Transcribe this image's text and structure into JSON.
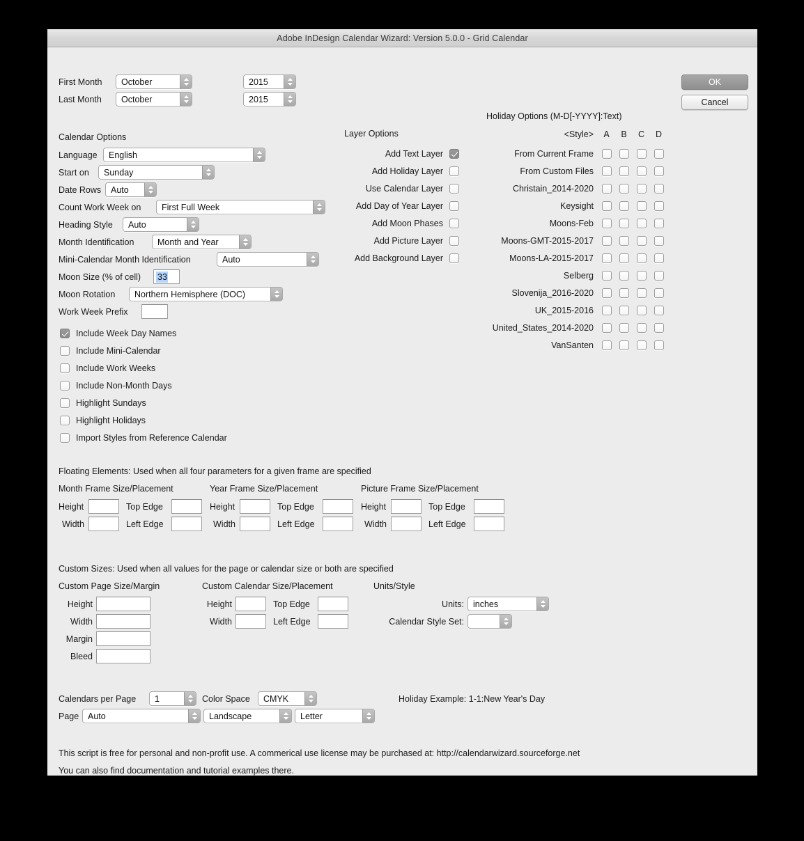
{
  "window": {
    "title": "Adobe InDesign Calendar Wizard: Version 5.0.0 - Grid Calendar"
  },
  "buttons": {
    "ok": "OK",
    "cancel": "Cancel"
  },
  "month_range": {
    "first_month_label": "First Month",
    "first_month_value": "October",
    "first_year_value": "2015",
    "last_month_label": "Last Month",
    "last_month_value": "October",
    "last_year_value": "2015"
  },
  "calendar_options": {
    "title": "Calendar Options",
    "fields": [
      {
        "label": "Language",
        "value": "English",
        "type": "popup"
      },
      {
        "label": "Start on",
        "value": "Sunday",
        "type": "popup"
      },
      {
        "label": "Date Rows",
        "value": "Auto",
        "type": "popup"
      },
      {
        "label": "Count Work Week on",
        "value": "First Full Week",
        "type": "popup"
      },
      {
        "label": "Heading Style",
        "value": "Auto",
        "type": "popup"
      },
      {
        "label": "Month Identification",
        "value": "Month and Year",
        "type": "popup"
      },
      {
        "label": "Mini-Calendar Month Identification",
        "value": "Auto",
        "type": "popup"
      },
      {
        "label": "Moon Size (% of cell)",
        "value": "33",
        "type": "text"
      },
      {
        "label": "Moon Rotation",
        "value": "Northern Hemisphere (DOC)",
        "type": "popup"
      },
      {
        "label": "Work Week Prefix",
        "value": "",
        "type": "text"
      }
    ],
    "checkboxes": [
      {
        "label": "Include Week Day Names",
        "checked": true
      },
      {
        "label": "Include Mini-Calendar",
        "checked": false
      },
      {
        "label": "Include Work Weeks",
        "checked": false
      },
      {
        "label": "Include Non-Month Days",
        "checked": false
      },
      {
        "label": "Highlight Sundays",
        "checked": false
      },
      {
        "label": "Highlight Holidays",
        "checked": false
      },
      {
        "label": "Import Styles from Reference Calendar",
        "checked": false
      }
    ]
  },
  "layer_options": {
    "title": "Layer Options",
    "items": [
      {
        "label": "Add Text Layer",
        "checked": true
      },
      {
        "label": "Add Holiday Layer",
        "checked": false
      },
      {
        "label": "Use Calendar Layer",
        "checked": false
      },
      {
        "label": "Add Day of Year Layer",
        "checked": false
      },
      {
        "label": "Add Moon Phases",
        "checked": false
      },
      {
        "label": "Add Picture Layer",
        "checked": false
      },
      {
        "label": "Add Background Layer",
        "checked": false
      }
    ]
  },
  "holiday_options": {
    "title": "Holiday Options (M-D[-YYYY]:Text)",
    "style_header": "<Style>",
    "columns": [
      "A",
      "B",
      "C",
      "D"
    ],
    "rows": [
      {
        "label": "From Current Frame",
        "checked": [
          false,
          false,
          false,
          false
        ]
      },
      {
        "label": "From Custom Files",
        "checked": [
          false,
          false,
          false,
          false
        ]
      },
      {
        "label": "Christain_2014-2020",
        "checked": [
          false,
          false,
          false,
          false
        ]
      },
      {
        "label": "Keysight",
        "checked": [
          false,
          false,
          false,
          false
        ]
      },
      {
        "label": "Moons-Feb",
        "checked": [
          false,
          false,
          false,
          false
        ]
      },
      {
        "label": "Moons-GMT-2015-2017",
        "checked": [
          false,
          false,
          false,
          false
        ]
      },
      {
        "label": "Moons-LA-2015-2017",
        "checked": [
          false,
          false,
          false,
          false
        ]
      },
      {
        "label": "Selberg",
        "checked": [
          false,
          false,
          false,
          false
        ]
      },
      {
        "label": "Slovenija_2016-2020",
        "checked": [
          false,
          false,
          false,
          false
        ]
      },
      {
        "label": "UK_2015-2016",
        "checked": [
          false,
          false,
          false,
          false
        ]
      },
      {
        "label": "United_States_2014-2020",
        "checked": [
          false,
          false,
          false,
          false
        ]
      },
      {
        "label": "VanSanten",
        "checked": [
          false,
          false,
          false,
          false
        ]
      }
    ]
  },
  "floating_elements": {
    "heading": "Floating Elements: Used when all four parameters for a given frame are specified",
    "groups": [
      {
        "title": "Month Frame Size/Placement",
        "fields": [
          {
            "label": "Height",
            "value": ""
          },
          {
            "label": "Top Edge",
            "value": ""
          },
          {
            "label": "Width",
            "value": ""
          },
          {
            "label": "Left Edge",
            "value": ""
          }
        ]
      },
      {
        "title": "Year Frame Size/Placement",
        "fields": [
          {
            "label": "Height",
            "value": ""
          },
          {
            "label": "Top Edge",
            "value": ""
          },
          {
            "label": "Width",
            "value": ""
          },
          {
            "label": "Left Edge",
            "value": ""
          }
        ]
      },
      {
        "title": "Picture Frame Size/Placement",
        "fields": [
          {
            "label": "Height",
            "value": ""
          },
          {
            "label": "Top Edge",
            "value": ""
          },
          {
            "label": "Width",
            "value": ""
          },
          {
            "label": "Left Edge",
            "value": ""
          }
        ]
      }
    ]
  },
  "custom_sizes": {
    "heading": "Custom Sizes: Used when all values for the page or calendar size or both are specified",
    "page_group": {
      "title": "Custom Page Size/Margin",
      "fields": [
        {
          "label": "Height",
          "value": ""
        },
        {
          "label": "Width",
          "value": ""
        },
        {
          "label": "Margin",
          "value": ""
        },
        {
          "label": "Bleed",
          "value": ""
        }
      ]
    },
    "calendar_group": {
      "title": "Custom Calendar Size/Placement",
      "fields": [
        {
          "label": "Height",
          "value": ""
        },
        {
          "label": "Top Edge",
          "value": ""
        },
        {
          "label": "Width",
          "value": ""
        },
        {
          "label": "Left Edge",
          "value": ""
        }
      ]
    },
    "units_group": {
      "title": "Units/Style",
      "units_label": "Units:",
      "units_value": "inches",
      "style_set_label": "Calendar Style Set:",
      "style_set_value": ""
    }
  },
  "bottom": {
    "calendars_per_page_label": "Calendars per Page",
    "calendars_per_page_value": "1",
    "color_space_label": "Color Space",
    "color_space_value": "CMYK",
    "page_label": "Page",
    "page_value": "Auto",
    "orientation_value": "Landscape",
    "paper_value": "Letter",
    "holiday_example": "Holiday Example: 1-1:New Year's Day"
  },
  "footer": {
    "line1": "This script is free for personal and non-profit use.  A commerical use license may be purchased at: http://calendarwizard.sourceforge.net",
    "line2": "You can also find documentation and tutorial examples there."
  }
}
